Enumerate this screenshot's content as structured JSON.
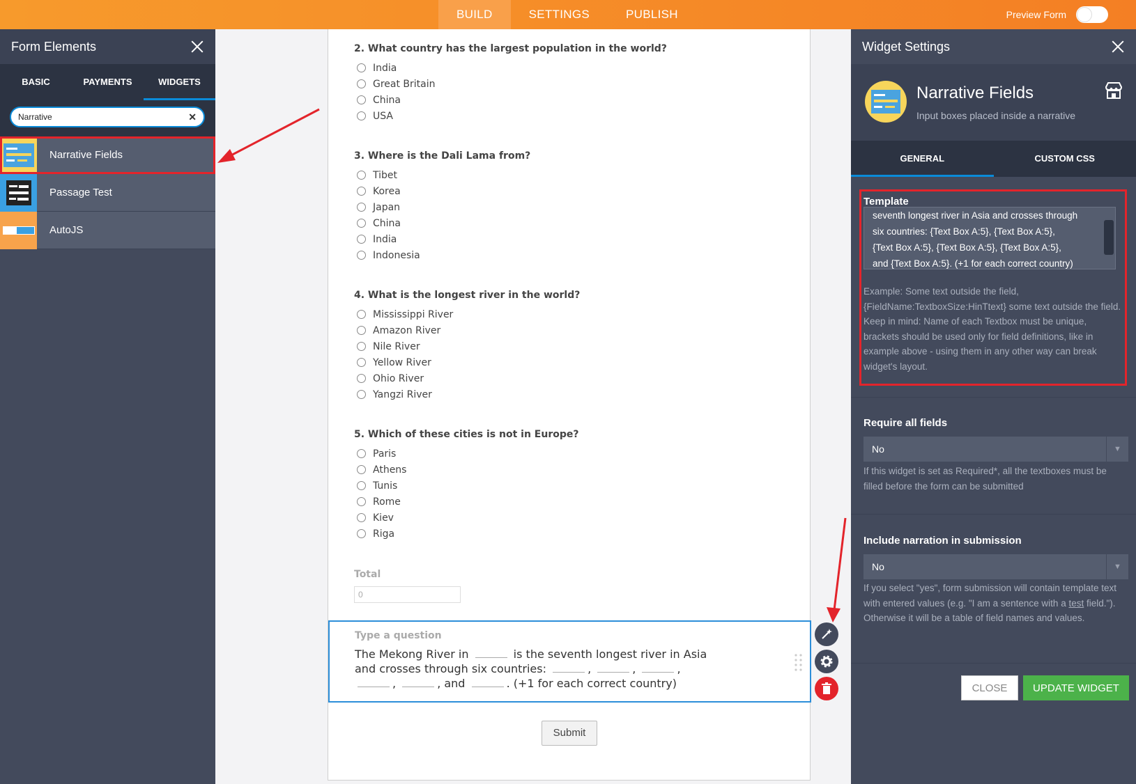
{
  "topbar": {
    "tabs": [
      "BUILD",
      "SETTINGS",
      "PUBLISH"
    ],
    "preview_label": "Preview Form"
  },
  "left_panel": {
    "title": "Form Elements",
    "tabs": [
      "BASIC",
      "PAYMENTS",
      "WIDGETS"
    ],
    "search_value": "Narrative",
    "items": [
      {
        "label": "Narrative Fields"
      },
      {
        "label": "Passage Test"
      },
      {
        "label": "AutoJS"
      }
    ]
  },
  "form": {
    "questions": [
      {
        "title": "2. What country has the largest population in the world?",
        "options": [
          "India",
          "Great Britain",
          "China",
          "USA"
        ]
      },
      {
        "title": "3. Where is the Dali Lama from?",
        "options": [
          "Tibet",
          "Korea",
          "Japan",
          "China",
          "India",
          "Indonesia"
        ]
      },
      {
        "title": "4. What is the longest river in the world?",
        "options": [
          "Mississippi River",
          "Amazon River",
          "Nile River",
          "Yellow River",
          "Ohio River",
          "Yangzi River"
        ]
      },
      {
        "title": "5. Which of these cities is not in Europe?",
        "options": [
          "Paris",
          "Athens",
          "Tunis",
          "Rome",
          "Kiev",
          "Riga"
        ]
      }
    ],
    "total_label": "Total",
    "total_value": "0",
    "narrative_title": "Type a question",
    "narrative_parts": [
      "The Mekong River in",
      "is the seventh longest river in Asia and crosses through six countries:",
      ",",
      ",",
      ",",
      ",",
      ", and",
      ". (+1 for each correct country)"
    ],
    "submit_label": "Submit"
  },
  "right_panel": {
    "title": "Widget Settings",
    "widget_name": "Narrative Fields",
    "widget_desc": "Input boxes placed inside a narrative",
    "tabs": [
      "GENERAL",
      "CUSTOM CSS"
    ],
    "template_title": "Template",
    "template_lines": [
      "seventh longest river in Asia and crosses through",
      "six countries: {Text Box A:5}, {Text Box A:5},",
      "{Text Box A:5}, {Text Box A:5}, {Text Box A:5},",
      "and {Text Box A:5}. (+1 for each correct country)"
    ],
    "template_help": "Example: Some text outside the field, {FieldName:TextboxSize:HinTtext} some text outside the field. Keep in mind: Name of each Textbox must be unique, brackets should be used only for field definitions, like in example above - using them in any other way can break widget's layout.",
    "require_title": "Require all fields",
    "require_value": "No",
    "require_help": "If this widget is set as Required*, all the textboxes must be filled before the form can be submitted",
    "narration_title": "Include narration in submission",
    "narration_value": "No",
    "narration_help_pre": "If you select \"yes\", form submission will contain template text with entered values (e.g. \"I am a sentence with a ",
    "narration_help_link": "test",
    "narration_help_post": " field.\"). Otherwise it will be a table of field names and values.",
    "close_label": "CLOSE",
    "update_label": "UPDATE WIDGET"
  },
  "colors": {
    "topbar": "#f47f24",
    "accent_blue": "#0a8bd9",
    "highlight_red": "#e3242b",
    "update_green": "#4cb24a"
  }
}
